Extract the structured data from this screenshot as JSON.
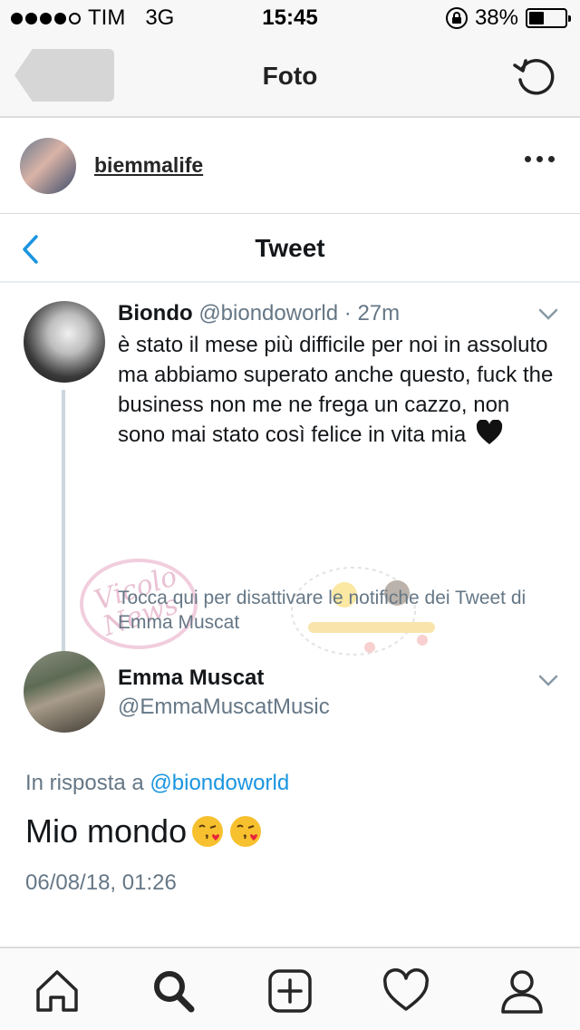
{
  "status_bar": {
    "carrier": "TIM",
    "network": "3G",
    "time": "15:45",
    "battery_percent": "38%",
    "battery_level": 0.38,
    "signal_bars": 4,
    "signal_max": 5
  },
  "nav": {
    "title": "Foto"
  },
  "post": {
    "username": "biemmalife"
  },
  "tweet_view": {
    "title": "Tweet"
  },
  "tweet1": {
    "name": "Biondo",
    "handle": "@biondoworld",
    "separator": "·",
    "age": "27m",
    "text": "è stato il mese più difficile per noi in assoluto ma abbiamo superato anche questo, fuck the business non me ne frega un cazzo, non sono mai stato così felice in vita mia"
  },
  "notification_hint": "Tocca qui per disattivare le notifiche dei Tweet di Emma Muscat",
  "tweet2": {
    "name": "Emma Muscat",
    "handle": "@EmmaMuscatMusic",
    "reply_prefix": "In risposta a",
    "reply_mention": "@biondoworld",
    "text": "Mio mondo",
    "timestamp": "06/08/18, 01:26"
  },
  "colors": {
    "twitter_blue": "#1b95e0",
    "secondary_text": "#657786",
    "thread_line": "#ccd6dd",
    "bar_background": "#f7f7f7"
  },
  "icons": {
    "tabs": [
      "home-icon",
      "search-icon",
      "add-post-icon",
      "heart-icon",
      "profile-icon"
    ]
  }
}
